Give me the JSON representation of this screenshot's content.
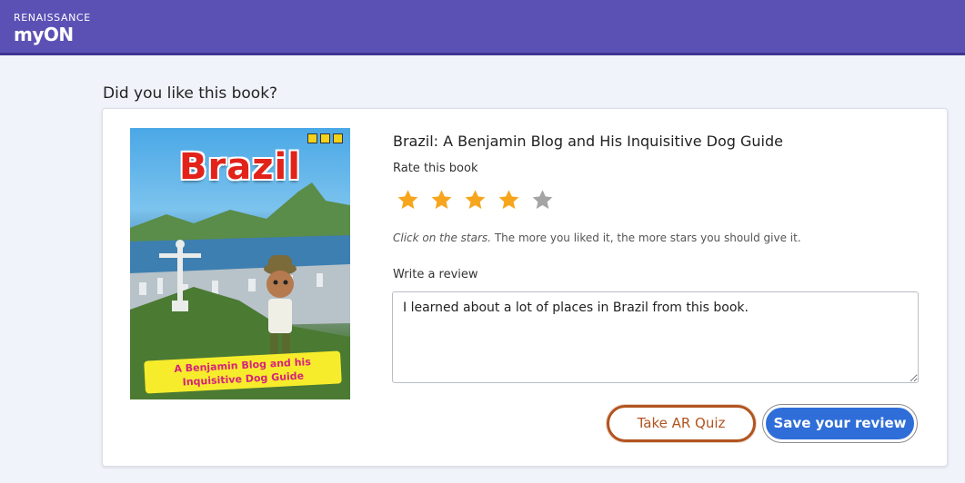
{
  "header": {
    "brand_small": "RENAISSANCE",
    "brand_big": "myON",
    "background_color": "#5b51b5"
  },
  "page": {
    "heading": "Did you like this book?"
  },
  "book": {
    "title": "Brazil: A Benjamin Blog and His Inquisitive Dog Guide",
    "cover": {
      "title_text": "Brazil",
      "banner_line1": "A Benjamin Blog and his",
      "banner_line2": "Inquisitive Dog Guide"
    }
  },
  "rating": {
    "label": "Rate this book",
    "value": 4,
    "max": 5,
    "filled_color": "#f7a51c",
    "empty_color": "#a4a4a4",
    "hint_italic": "Click on the stars.",
    "hint_rest": " The more you liked it, the more stars you should give it."
  },
  "review": {
    "label": "Write a review",
    "value": "I learned about a lot of places in Brazil from this book."
  },
  "actions": {
    "quiz_label": "Take AR Quiz",
    "save_label": "Save your review",
    "quiz_color": "#b2541f",
    "save_color": "#2f6ed8"
  }
}
